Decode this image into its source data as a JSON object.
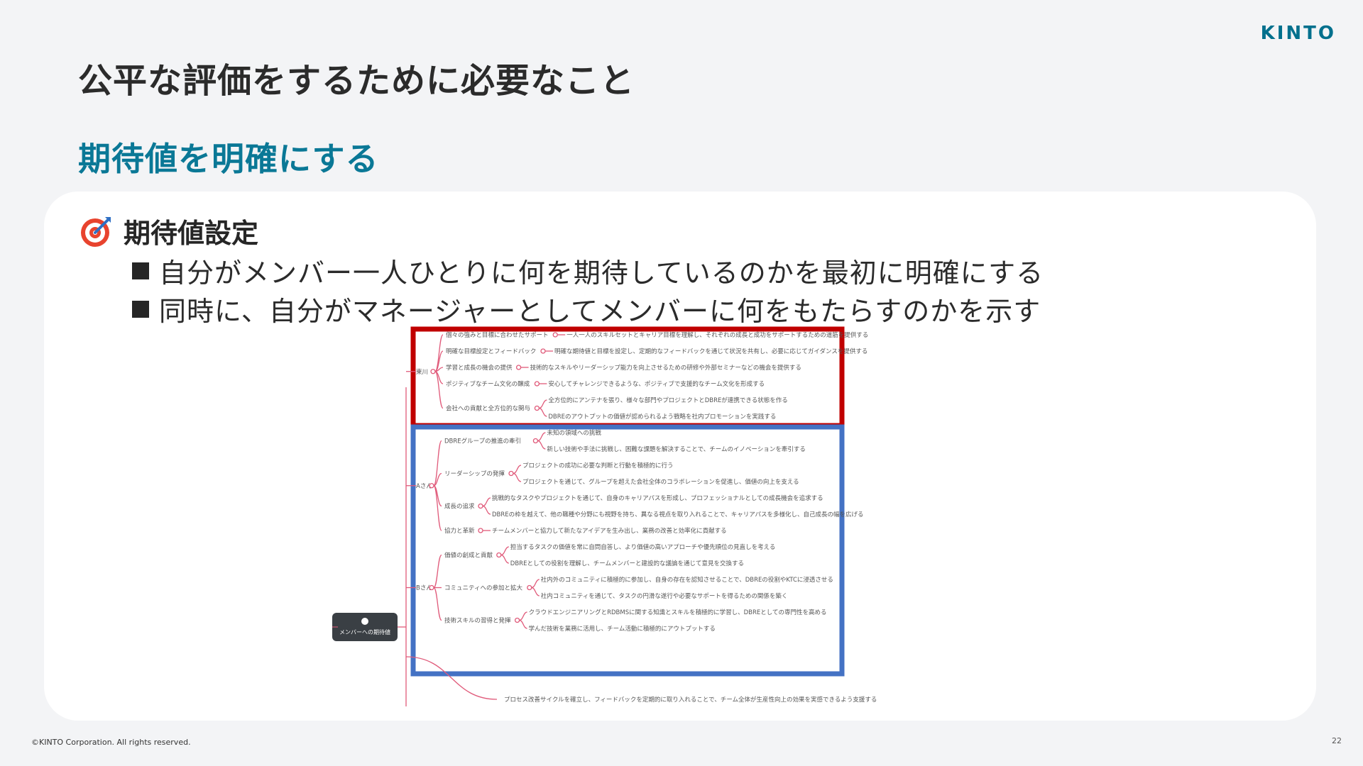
{
  "brand": {
    "logo_text": "KINTO"
  },
  "slide": {
    "title": "公平な評価をするために必要なこと",
    "subtitle": "期待値を明確にする",
    "section_heading": "期待値設定",
    "heading_icon": "dart-target-icon",
    "bullets": [
      "自分がメンバー一人ひとりに何を期待しているのかを最初に明確にする",
      "同時に、自分がマネージャーとしてメンバーに何をもたらすのかを示す"
    ]
  },
  "mindmap": {
    "root_label": "メンバーへの期待値",
    "colors": {
      "manager_box": "#c00000",
      "members_box": "#4472c4",
      "branch": "#e05a7a",
      "root_bg": "#3a3f44"
    },
    "manager": {
      "label": "東川",
      "items": [
        {
          "label": "個々の強みと目標に合わせたサポート",
          "details": [
            "一人一人のスキルセットとキャリア目標を理解し、それぞれの成長と成功をサポートするための道筋を提供する"
          ]
        },
        {
          "label": "明確な目標設定とフィードバック",
          "details": [
            "明確な期待値と目標を設定し、定期的なフィードバックを通じて状況を共有し、必要に応じてガイダンスを提供する"
          ]
        },
        {
          "label": "学習と成長の機会の提供",
          "details": [
            "技術的なスキルやリーダーシップ能力を向上させるための研修や外部セミナーなどの機会を提供する"
          ]
        },
        {
          "label": "ポジティブなチーム文化の醸成",
          "details": [
            "安心してチャレンジできるような、ポジティブで支援的なチーム文化を形成する"
          ]
        },
        {
          "label": "会社への貢献と全方位的な関与",
          "details": [
            "全方位的にアンテナを張り、様々な部門やプロジェクトとDBREが連携できる状態を作る",
            "DBREのアウトプットの価値が認められるよう戦略を社内プロモーションを実践する"
          ]
        }
      ]
    },
    "members": [
      {
        "label": "Aさん",
        "items": [
          {
            "label": "DBREグループの推進の牽引",
            "details": [
              "未知の領域への挑戦",
              "新しい技術や手法に挑戦し、困難な課題を解決することで、チームのイノベーションを牽引する"
            ]
          },
          {
            "label": "リーダーシップの発揮",
            "details": [
              "プロジェクトの成功に必要な判断と行動を積極的に行う",
              "プロジェクトを通じて、グループを超えた会社全体のコラボレーションを促進し、価値の向上を支える"
            ]
          },
          {
            "label": "成長の追求",
            "details": [
              "挑戦的なタスクやプロジェクトを通じて、自身のキャリアパスを形成し、プロフェッショナルとしての成長機会を追求する",
              "DBREの枠を越えて、他の職種や分野にも視野を持ち、異なる視点を取り入れることで、キャリアパスを多様化し、自己成長の幅を広げる"
            ]
          },
          {
            "label": "協力と革新",
            "details": [
              "チームメンバーと協力して新たなアイデアを生み出し、業務の改善と効率化に貢献する"
            ]
          }
        ]
      },
      {
        "label": "Bさん",
        "items": [
          {
            "label": "価値の創成と貢献",
            "details": [
              "担当するタスクの価値を常に自問自答し、より価値の高いアプローチや優先順位の見直しを考える",
              "DBREとしての役割を理解し、チームメンバーと建設的な議論を通じて意見を交換する"
            ]
          },
          {
            "label": "コミュニティへの参加と拡大",
            "details": [
              "社内外のコミュニティに積極的に参加し、自身の存在を認知させることで、DBREの役割やKTCに浸透させる",
              "社内コミュニティを通じて、タスクの円滑な遂行や必要なサポートを得るための関係を築く"
            ]
          },
          {
            "label": "技術スキルの習得と発揮",
            "details": [
              "クラウドエンジニアリングとRDBMSに関する知識とスキルを積極的に学習し、DBREとしての専門性を高める",
              "学んだ技術を業務に活用し、チーム活動に積極的にアウトプットする"
            ]
          }
        ]
      }
    ],
    "trailing_detail": "プロセス改善サイクルを確立し、フィードバックを定期的に取り入れることで、チーム全体が生産性向上の効果を実感できるよう支援する"
  },
  "footer": {
    "copyright": "©KINTO Corporation. All rights reserved.",
    "page_number": "22"
  }
}
